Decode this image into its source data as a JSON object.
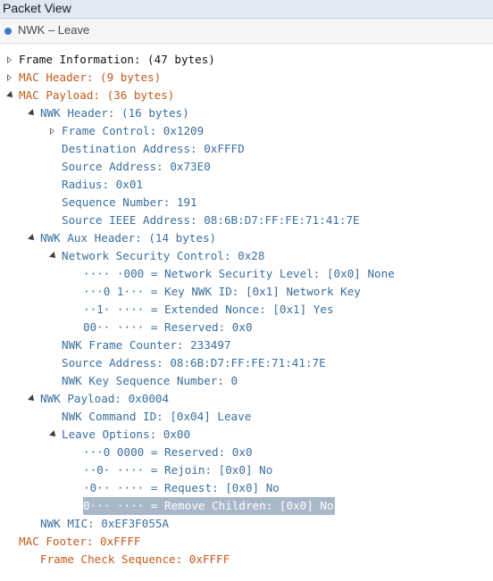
{
  "window": {
    "title": "Packet View"
  },
  "packet": {
    "summary": "NWK – Leave"
  },
  "tree": [
    {
      "depth": 0,
      "toggle": "closed",
      "color": "black",
      "text": "Frame Information: (47 bytes)"
    },
    {
      "depth": 0,
      "toggle": "closed",
      "color": "orange",
      "text": "MAC Header: (9 bytes)"
    },
    {
      "depth": 0,
      "toggle": "open",
      "color": "orange",
      "text": "MAC Payload: (36 bytes)"
    },
    {
      "depth": 1,
      "toggle": "open",
      "color": "blue",
      "text": "NWK Header: (16 bytes)"
    },
    {
      "depth": 2,
      "toggle": "closed",
      "color": "blue",
      "text": "Frame Control: 0x1209"
    },
    {
      "depth": 2,
      "toggle": "none",
      "color": "blue",
      "text": "Destination Address: 0xFFFD"
    },
    {
      "depth": 2,
      "toggle": "none",
      "color": "blue",
      "text": "Source Address: 0x73E0"
    },
    {
      "depth": 2,
      "toggle": "none",
      "color": "blue",
      "text": "Radius: 0x01"
    },
    {
      "depth": 2,
      "toggle": "none",
      "color": "blue",
      "text": "Sequence Number: 191"
    },
    {
      "depth": 2,
      "toggle": "none",
      "color": "blue",
      "text": "Source IEEE Address: 08:6B:D7:FF:FE:71:41:7E"
    },
    {
      "depth": 1,
      "toggle": "open",
      "color": "blue",
      "text": "NWK Aux Header: (14 bytes)"
    },
    {
      "depth": 2,
      "toggle": "open",
      "color": "blue",
      "text": "Network Security Control: 0x28"
    },
    {
      "depth": 3,
      "toggle": "none",
      "color": "blue",
      "text": "···· ·000 = Network Security Level: [0x0] None"
    },
    {
      "depth": 3,
      "toggle": "none",
      "color": "blue",
      "text": "···0 1··· = Key NWK ID: [0x1] Network Key"
    },
    {
      "depth": 3,
      "toggle": "none",
      "color": "blue",
      "text": "··1· ···· = Extended Nonce: [0x1] Yes"
    },
    {
      "depth": 3,
      "toggle": "none",
      "color": "blue",
      "text": "00·· ···· = Reserved: 0x0"
    },
    {
      "depth": 2,
      "toggle": "none",
      "color": "blue",
      "text": "NWK Frame Counter: 233497"
    },
    {
      "depth": 2,
      "toggle": "none",
      "color": "blue",
      "text": "Source Address: 08:6B:D7:FF:FE:71:41:7E"
    },
    {
      "depth": 2,
      "toggle": "none",
      "color": "blue",
      "text": "NWK Key Sequence Number: 0"
    },
    {
      "depth": 1,
      "toggle": "open",
      "color": "blue",
      "text": "NWK Payload: 0x0004"
    },
    {
      "depth": 2,
      "toggle": "none",
      "color": "blue",
      "text": "NWK Command ID: [0x04] Leave"
    },
    {
      "depth": 2,
      "toggle": "open",
      "color": "blue",
      "text": "Leave Options: 0x00"
    },
    {
      "depth": 3,
      "toggle": "none",
      "color": "blue",
      "text": "···0 0000 = Reserved: 0x0"
    },
    {
      "depth": 3,
      "toggle": "none",
      "color": "blue",
      "text": "··0· ···· = Rejoin: [0x0] No"
    },
    {
      "depth": 3,
      "toggle": "none",
      "color": "blue",
      "text": "·0·· ···· = Request: [0x0] No"
    },
    {
      "depth": 3,
      "toggle": "none",
      "color": "blue",
      "selected": true,
      "text": "0··· ···· = Remove Children: [0x0] No"
    },
    {
      "depth": 1,
      "toggle": "none",
      "color": "blue",
      "text": "NWK MIC: 0xEF3F055A"
    },
    {
      "depth": 0,
      "toggle": "none",
      "color": "orange",
      "text": "MAC Footer: 0xFFFF"
    },
    {
      "depth": 1,
      "toggle": "none",
      "color": "orange",
      "text": "Frame Check Sequence: 0xFFFF"
    }
  ]
}
